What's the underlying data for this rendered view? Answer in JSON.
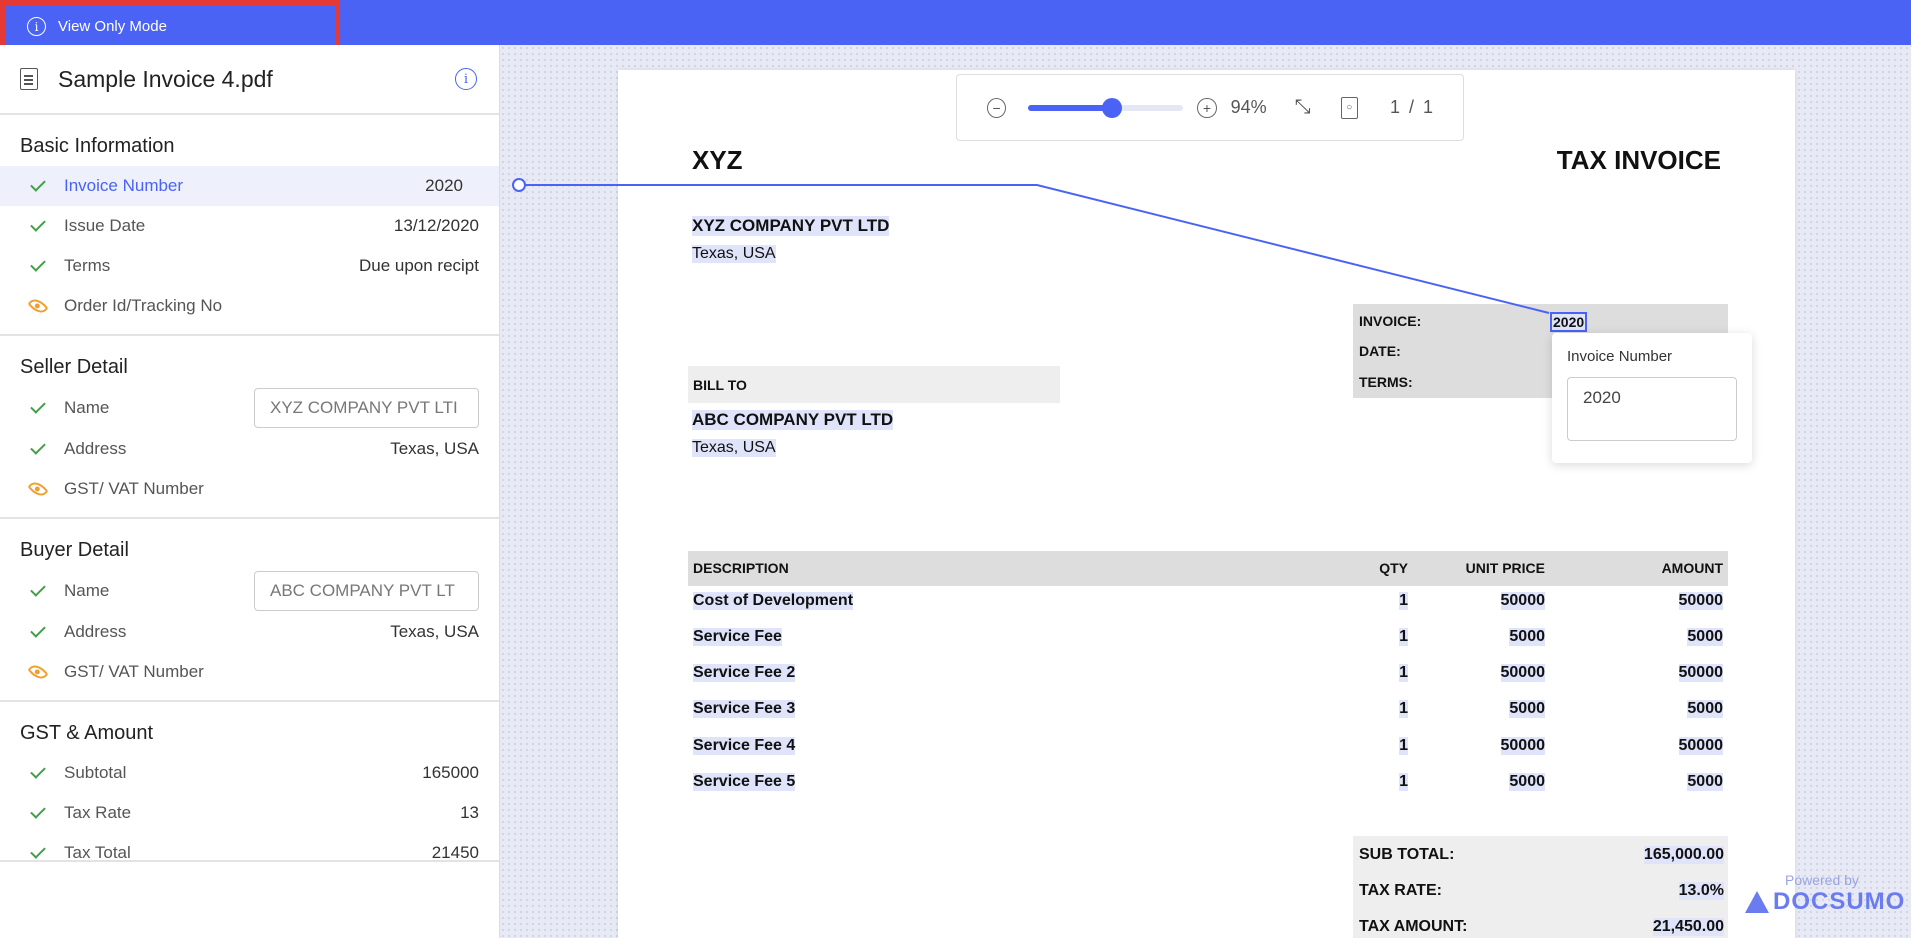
{
  "topbar": {
    "mode_label": "View Only Mode"
  },
  "file": {
    "name": "Sample Invoice 4.pdf"
  },
  "sections": {
    "basic": {
      "title": "Basic Information",
      "invoice_number": {
        "label": "Invoice Number",
        "value": "2020"
      },
      "issue_date": {
        "label": "Issue Date",
        "value": "13/12/2020"
      },
      "terms": {
        "label": "Terms",
        "value": "Due upon recipt"
      },
      "order_id": {
        "label": "Order Id/Tracking No"
      }
    },
    "seller": {
      "title": "Seller Detail",
      "name": {
        "label": "Name",
        "value": "XYZ COMPANY PVT LTI"
      },
      "address": {
        "label": "Address",
        "value": "Texas, USA"
      },
      "gst": {
        "label": "GST/ VAT Number"
      }
    },
    "buyer": {
      "title": "Buyer Detail",
      "name": {
        "label": "Name",
        "value": "ABC COMPANY PVT LT"
      },
      "address": {
        "label": "Address",
        "value": "Texas, USA"
      },
      "gst": {
        "label": "GST/ VAT Number"
      }
    },
    "amount": {
      "title": "GST & Amount",
      "subtotal": {
        "label": "Subtotal",
        "value": "165000"
      },
      "tax_rate": {
        "label": "Tax Rate",
        "value": "13"
      },
      "tax_total": {
        "label": "Tax Total",
        "value": "21450"
      }
    }
  },
  "toolbar": {
    "zoom": "94%",
    "zoom_fraction": 0.54,
    "page_current": "1",
    "page_sep": "/",
    "page_total": "1"
  },
  "invoice": {
    "company": "XYZ",
    "doc_title": "TAX INVOICE",
    "seller_name": "XYZ COMPANY PVT LTD",
    "seller_address": "Texas, USA",
    "invoice_label": "INVOICE:",
    "invoice_value": "2020",
    "date_label": "DATE:",
    "terms_label": "TERMS:",
    "bill_to": "BILL TO",
    "buyer_name": "ABC COMPANY PVT LTD",
    "buyer_address": "Texas, USA",
    "columns": {
      "description": "DESCRIPTION",
      "qty": "QTY",
      "unit_price": "UNIT PRICE",
      "amount": "AMOUNT"
    },
    "items": [
      {
        "description": "Cost of Development",
        "qty": "1",
        "unit_price": "50000",
        "amount": "50000"
      },
      {
        "description": "Service Fee",
        "qty": "1",
        "unit_price": "5000",
        "amount": "5000"
      },
      {
        "description": "Service Fee 2",
        "qty": "1",
        "unit_price": "50000",
        "amount": "50000"
      },
      {
        "description": "Service Fee 3",
        "qty": "1",
        "unit_price": "5000",
        "amount": "5000"
      },
      {
        "description": "Service Fee 4",
        "qty": "1",
        "unit_price": "50000",
        "amount": "50000"
      },
      {
        "description": "Service Fee 5",
        "qty": "1",
        "unit_price": "5000",
        "amount": "5000"
      }
    ],
    "sub_total_label": "SUB TOTAL:",
    "sub_total_value": "165,000.00",
    "tax_rate_label": "TAX RATE:",
    "tax_rate_value": "13.0%",
    "tax_amount_label": "TAX AMOUNT:",
    "tax_amount_value": "21,450.00"
  },
  "popup": {
    "label": "Invoice Number",
    "value": "2020"
  },
  "branding": {
    "powered_by": "Powered by",
    "name": "DOCSUMO"
  },
  "colors": {
    "accent": "#4a63f5",
    "success": "#43a047",
    "warning": "#f0a030",
    "highlight_border": "#e53935"
  }
}
